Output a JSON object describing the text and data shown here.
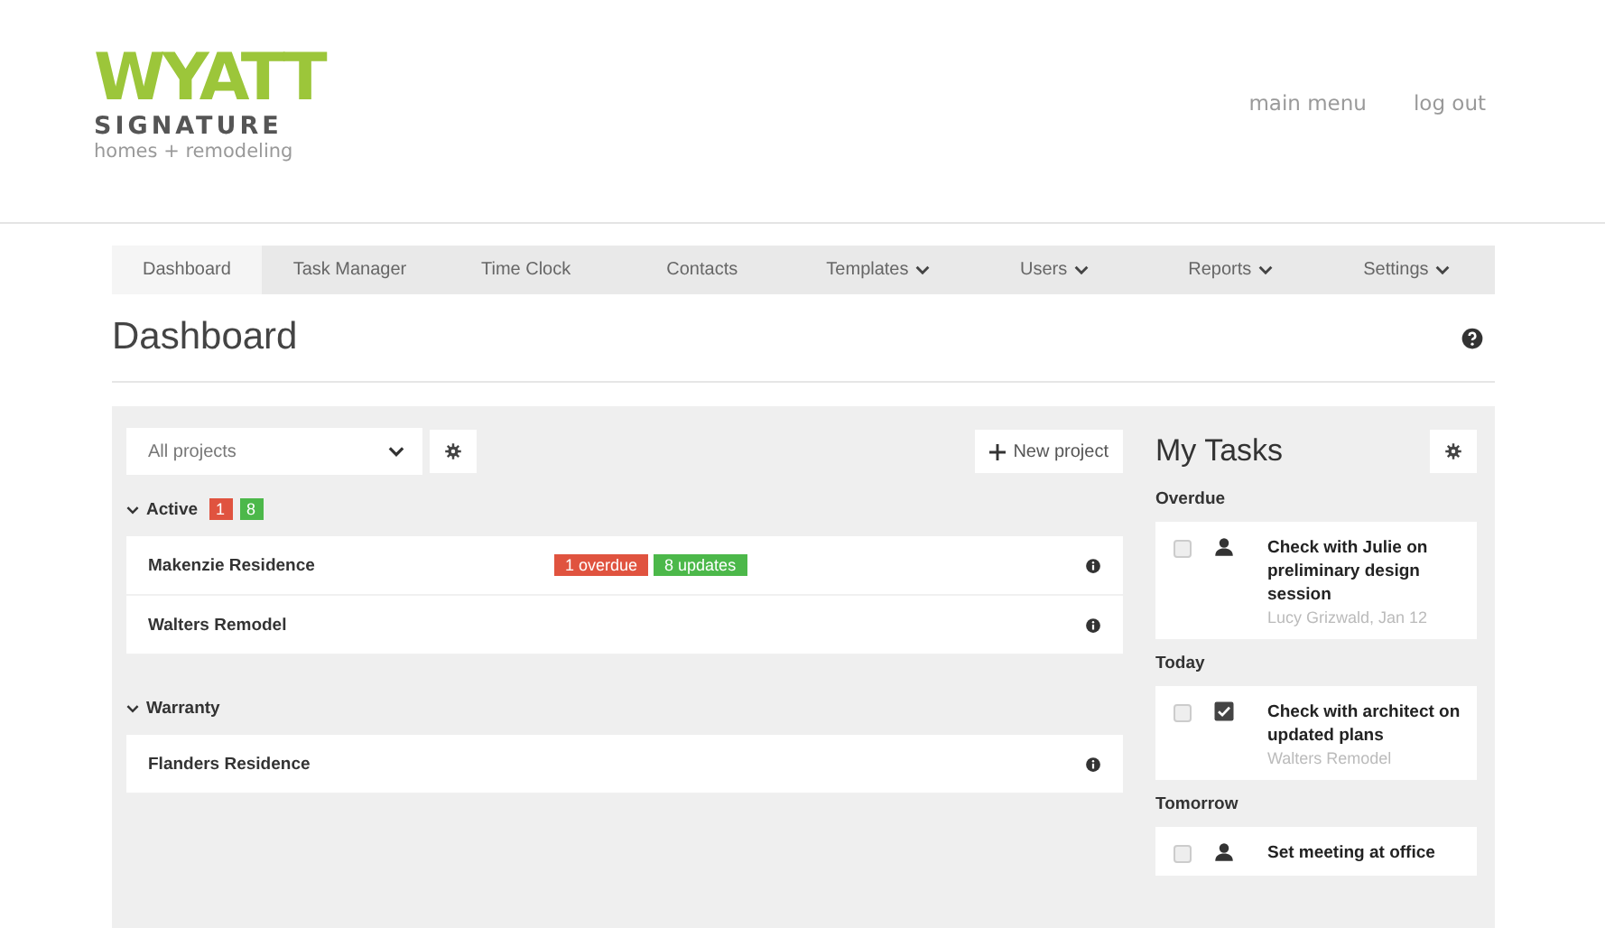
{
  "logo": {
    "brand": "WYATT",
    "line2": "SIGNATURE",
    "line3": "homes + remodeling"
  },
  "header_links": [
    "main menu",
    "log out"
  ],
  "nav": [
    {
      "label": "Dashboard",
      "selected": true,
      "dropdown": false
    },
    {
      "label": "Task Manager",
      "selected": false,
      "dropdown": false
    },
    {
      "label": "Time Clock",
      "selected": false,
      "dropdown": false
    },
    {
      "label": "Contacts",
      "selected": false,
      "dropdown": false
    },
    {
      "label": "Templates",
      "selected": false,
      "dropdown": true
    },
    {
      "label": "Users",
      "selected": false,
      "dropdown": true
    },
    {
      "label": "Reports",
      "selected": false,
      "dropdown": true
    },
    {
      "label": "Settings",
      "selected": false,
      "dropdown": true
    }
  ],
  "page_title": "Dashboard",
  "projects": {
    "filter": "All projects",
    "new_button": "New project",
    "groups": [
      {
        "name": "Active",
        "expanded": true,
        "badges": [
          {
            "text": "1",
            "color": "#e0533f"
          },
          {
            "text": "8",
            "color": "#4cb84a"
          }
        ],
        "items": [
          {
            "name": "Makenzie Residence",
            "tags": [
              {
                "text": "1 overdue",
                "color": "#e0533f"
              },
              {
                "text": "8 updates",
                "color": "#4cb84a"
              }
            ]
          },
          {
            "name": "Walters Remodel"
          }
        ]
      },
      {
        "name": "Warranty",
        "expanded": true,
        "items": [
          {
            "name": "Flanders Residence"
          }
        ]
      }
    ]
  },
  "my_tasks": {
    "title": "My Tasks",
    "sections": [
      {
        "heading": "Overdue",
        "tasks": [
          {
            "title": "Check with Julie on preliminary design session",
            "meta": "Lucy Grizwald, Jan 12",
            "checked": false,
            "kind": "person"
          }
        ]
      },
      {
        "heading": "Today",
        "tasks": [
          {
            "title": "Check with architect on updated plans",
            "meta": "Walters Remodel",
            "checked": false,
            "kind": "checklist"
          }
        ]
      },
      {
        "heading": "Tomorrow",
        "tasks": [
          {
            "title": "Set meeting at office",
            "checked": false,
            "kind": "person"
          }
        ]
      }
    ]
  }
}
